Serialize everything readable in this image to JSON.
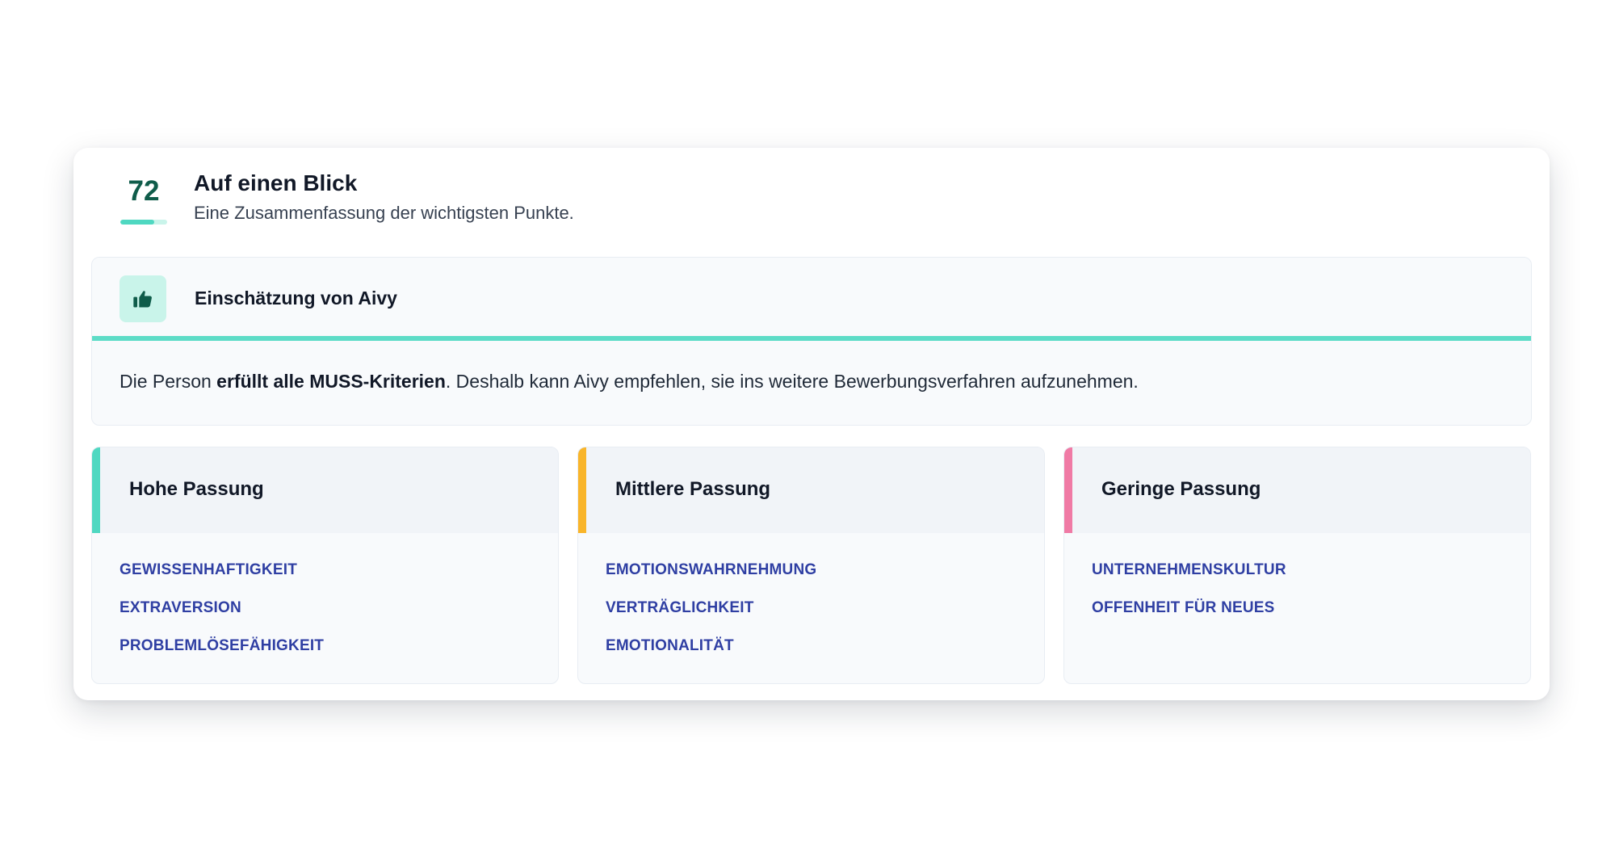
{
  "summary": {
    "score": "72",
    "score_fraction": 0.72,
    "title": "Auf einen Blick",
    "subtitle": "Eine Zusammenfassung der wichtigsten Punkte."
  },
  "assessment": {
    "icon": "thumbs-up-icon",
    "title": "Einschätzung von Aivy",
    "text_before": "Die Person ",
    "text_bold": "erfüllt alle MUSS-Kriterien",
    "text_after": ". Deshalb kann Aivy empfehlen, sie ins weitere Bewerbungsverfahren aufzunehmen."
  },
  "fit_groups": [
    {
      "title": "Hohe Passung",
      "accent_color": "#4fd8c1",
      "items": [
        "GEWISSENHAFTIGKEIT",
        "EXTRAVERSION",
        "PROBLEMLÖSEFÄHIGKEIT"
      ]
    },
    {
      "title": "Mittlere Passung",
      "accent_color": "#f9b52a",
      "items": [
        "EMOTIONSWAHRNEHMUNG",
        "VERTRÄGLICHKEIT",
        "EMOTIONALITÄT"
      ]
    },
    {
      "title": "Geringe Passung",
      "accent_color": "#f07aa5",
      "items": [
        "UNTERNEHMENSKULTUR",
        "OFFENHEIT FÜR NEUES"
      ]
    }
  ],
  "colors": {
    "accent": "#5ddcc7",
    "score_text": "#0f5c4a",
    "link": "#2f3fa3"
  }
}
